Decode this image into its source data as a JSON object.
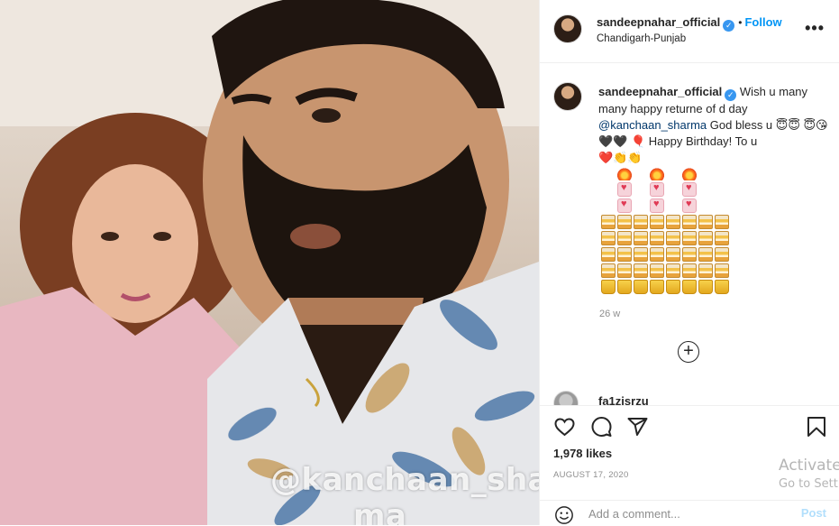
{
  "header": {
    "username": "sandeepnahar_official",
    "separator": "•",
    "follow_label": "Follow",
    "location": "Chandigarh-Punjab",
    "more_label": "•••"
  },
  "caption": {
    "username": "sandeepnahar_official",
    "text_1": "Wish u many many happy returne of d day",
    "mention": "@kanchaan_sharma",
    "text_2": "God bless u",
    "text_3": "Happy Birthday! To u",
    "time_ago": "26 w"
  },
  "next_comment": {
    "username": "fa1zisrzu"
  },
  "photo": {
    "overlay_text_line1": "@kanchaan_shar",
    "overlay_text_line2": "ma"
  },
  "actions": {
    "likes": "1,978 likes",
    "date": "AUGUST 17, 2020"
  },
  "add_comment": {
    "placeholder": "Add a comment...",
    "post_label": "Post"
  },
  "watermark": {
    "line1": "Activate",
    "line2": "Go to Sett"
  },
  "icons": [
    "verified-badge-icon",
    "more-options-icon",
    "load-more-icon",
    "heart-icon",
    "comment-icon",
    "share-icon",
    "bookmark-icon",
    "emoji-icon"
  ],
  "colors": {
    "link": "#0095f6",
    "mention": "#00376b",
    "muted": "#8e8e8e",
    "post_disabled": "#b2dffc"
  }
}
